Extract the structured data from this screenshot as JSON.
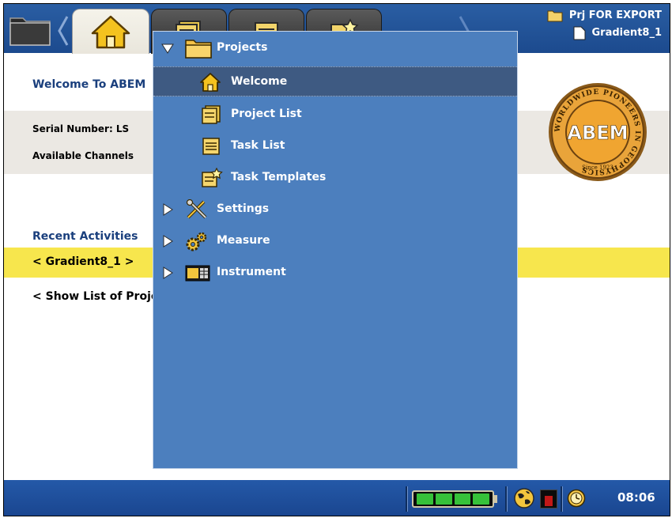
{
  "header": {
    "project_name": "Prj FOR EXPORT",
    "task_name": "Gradient8_1",
    "tabs": [
      {
        "icon": "home-icon",
        "active": true
      },
      {
        "icon": "project-list-icon",
        "active": false
      },
      {
        "icon": "task-list-icon",
        "active": false
      },
      {
        "icon": "task-templates-icon",
        "active": false
      }
    ]
  },
  "main": {
    "welcome_title": "Welcome To ABEM",
    "serial_label": "Serial Number: LS",
    "channels_label": "Available Channels",
    "logo": {
      "text": "ABEM",
      "ring_text": "WORLDWIDE PIONEERS IN GEOPHYSICS",
      "since": "Since 1923"
    },
    "recent_title": "Recent Activities",
    "recent_item": "< Gradient8_1 >",
    "show_list": "< Show List of Projects >"
  },
  "menu": {
    "items": [
      {
        "label": "Projects",
        "icon": "folder-icon",
        "expanded": true,
        "level": 0
      },
      {
        "label": "Welcome",
        "icon": "home-icon",
        "level": 1,
        "selected": true
      },
      {
        "label": "Project List",
        "icon": "project-list-icon",
        "level": 1
      },
      {
        "label": "Task List",
        "icon": "task-list-icon",
        "level": 1
      },
      {
        "label": "Task Templates",
        "icon": "task-templates-icon",
        "level": 1
      },
      {
        "label": "Settings",
        "icon": "tools-icon",
        "expanded": false,
        "level": 0
      },
      {
        "label": "Measure",
        "icon": "gears-icon",
        "expanded": false,
        "level": 0
      },
      {
        "label": "Instrument",
        "icon": "instrument-icon",
        "expanded": false,
        "level": 0
      }
    ]
  },
  "status": {
    "time": "08:06",
    "battery_cells": 4
  },
  "colors": {
    "top_bar": "#1c4a8e",
    "menu_bg": "#4c7fbe",
    "menu_selected": "#3e5a82",
    "highlight": "#f7e64d",
    "title_blue": "#1a3f7d"
  }
}
